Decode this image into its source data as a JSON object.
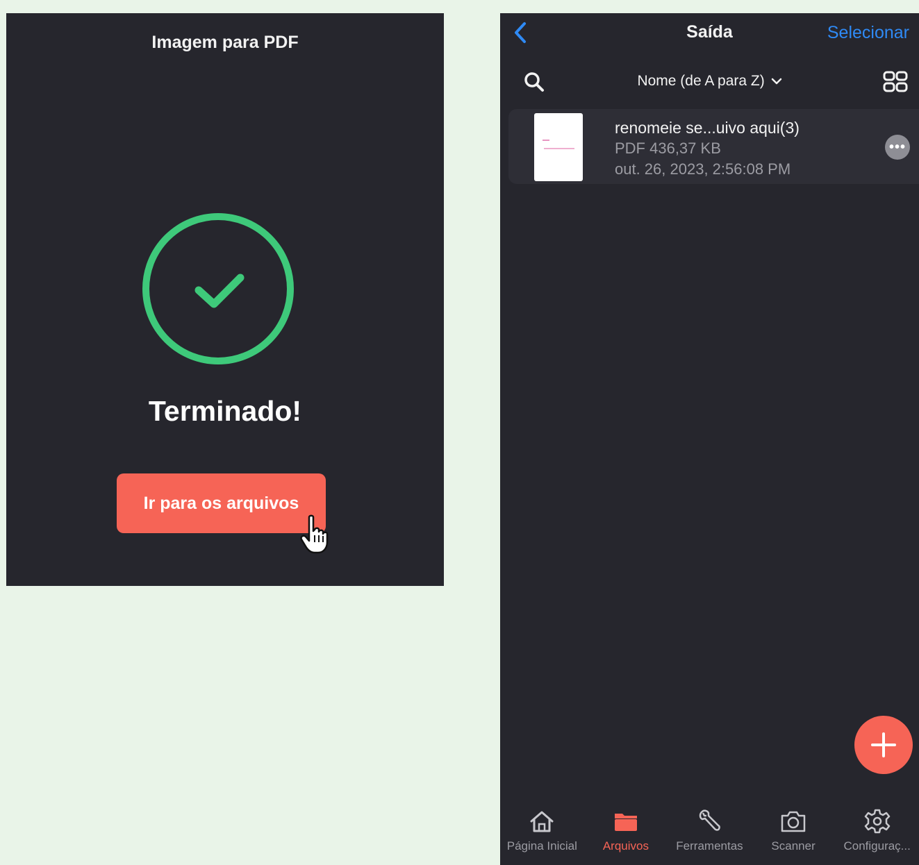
{
  "left_screen": {
    "title": "Imagem para PDF",
    "status": "Terminado!",
    "button_label": "Ir para os arquivos"
  },
  "right_screen": {
    "title": "Saída",
    "select_label": "Selecionar",
    "sort_label": "Nome (de A para Z)",
    "file": {
      "name": "renomeie se...uivo aqui(3)",
      "meta": "PDF 436,37 KB",
      "date": "out. 26, 2023, 2:56:08 PM"
    },
    "tabs": [
      {
        "label": "Página Inicial",
        "icon": "home-icon"
      },
      {
        "label": "Arquivos",
        "icon": "folder-icon",
        "active": true
      },
      {
        "label": "Ferramentas",
        "icon": "wrench-icon"
      },
      {
        "label": "Scanner",
        "icon": "camera-icon"
      },
      {
        "label": "Configuraç...",
        "icon": "gear-icon"
      }
    ]
  },
  "colors": {
    "accent": "#f66456",
    "success": "#3ec97a",
    "link": "#2f8af5",
    "background": "#26262d",
    "page_bg": "#e9f4e8"
  }
}
